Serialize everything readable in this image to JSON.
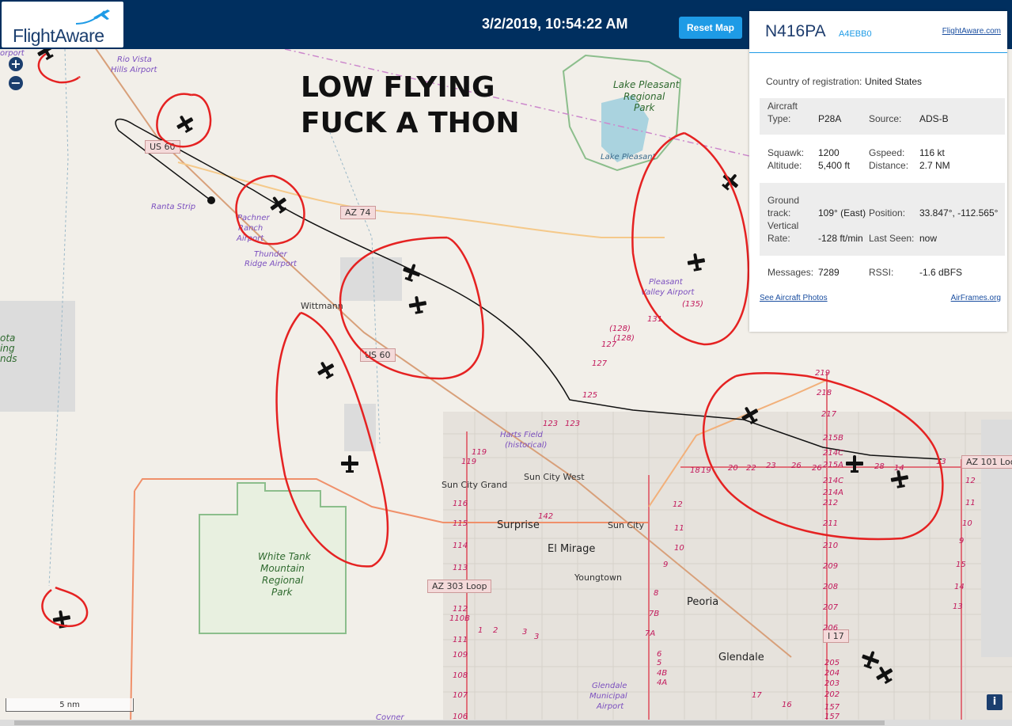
{
  "header": {
    "logo_text": "FlightAware",
    "timestamp": "3/2/2019, 10:54:22 AM",
    "reset_label": "Reset Map"
  },
  "overlay": {
    "line1": "LOW FLYING",
    "line2": "FUCK A THON"
  },
  "panel": {
    "registration": "N416PA",
    "hex": "A4EBB0",
    "site_link": "FlightAware.com",
    "country_label": "Country of registration:",
    "country": "United States",
    "aircraft_label": "Aircraft",
    "type_label": "Type:",
    "type": "P28A",
    "source_label": "Source:",
    "source": "ADS-B",
    "squawk_label": "Squawk:",
    "squawk": "1200",
    "gspeed_label": "Gspeed:",
    "gspeed": "116 kt",
    "altitude_label": "Altitude:",
    "altitude": "5,400 ft",
    "distance_label": "Distance:",
    "distance": "2.7 NM",
    "ground_label": "Ground",
    "track_label": "track:",
    "track": "109° (East)",
    "position_label": "Position:",
    "position": "33.847°, -112.565°",
    "vertical_label": "Vertical",
    "rate_label": "Rate:",
    "rate": "-128 ft/min",
    "lastseen_label": "Last Seen:",
    "lastseen": "now",
    "messages_label": "Messages:",
    "messages": "7289",
    "rssi_label": "RSSI:",
    "rssi": "-1.6 dBFS",
    "photos_link": "See Aircraft Photos",
    "airframes_link": "AirFrames.org"
  },
  "map": {
    "zoom_in": "+",
    "zoom_out": "−",
    "scale_label": "5 nm",
    "info_label": "i",
    "place_labels": [
      {
        "text": "Rio Vista",
        "kind": "airport"
      },
      {
        "text": "Hills Airport",
        "kind": "airport"
      },
      {
        "text": "Lake Pleasant",
        "kind": "park"
      },
      {
        "text": "Regional",
        "kind": "park"
      },
      {
        "text": "Park",
        "kind": "park"
      },
      {
        "text": "Lake Pleasant",
        "kind": "water"
      },
      {
        "text": "Ranta Strip",
        "kind": "airport"
      },
      {
        "text": "Pachner",
        "kind": "airport"
      },
      {
        "text": "Ranch",
        "kind": "airport"
      },
      {
        "text": "Airport",
        "kind": "airport"
      },
      {
        "text": "Thunder",
        "kind": "airport"
      },
      {
        "text": "Ridge Airport",
        "kind": "airport"
      },
      {
        "text": "Wittmann",
        "kind": "town"
      },
      {
        "text": "Pleasant",
        "kind": "airport"
      },
      {
        "text": "Valley Airport",
        "kind": "airport"
      },
      {
        "text": "Harts Field",
        "kind": "airport"
      },
      {
        "text": "(historical)",
        "kind": "airport"
      },
      {
        "text": "Sun City Grand",
        "kind": "town"
      },
      {
        "text": "Sun City West",
        "kind": "town"
      },
      {
        "text": "Surprise",
        "kind": "city"
      },
      {
        "text": "Sun City",
        "kind": "town"
      },
      {
        "text": "El Mirage",
        "kind": "city"
      },
      {
        "text": "Youngtown",
        "kind": "town"
      },
      {
        "text": "White Tank",
        "kind": "park"
      },
      {
        "text": "Mountain",
        "kind": "park"
      },
      {
        "text": "Regional",
        "kind": "park"
      },
      {
        "text": "Park",
        "kind": "park"
      },
      {
        "text": "Peoria",
        "kind": "city"
      },
      {
        "text": "Glendale",
        "kind": "city"
      },
      {
        "text": "Glendale",
        "kind": "airport"
      },
      {
        "text": "Municipal",
        "kind": "airport"
      },
      {
        "text": "Airport",
        "kind": "airport"
      },
      {
        "text": "Coyner",
        "kind": "airport"
      },
      {
        "text": "orport",
        "kind": "airport"
      },
      {
        "text": "ota",
        "kind": "park"
      },
      {
        "text": "ing",
        "kind": "park"
      },
      {
        "text": "nds",
        "kind": "park"
      }
    ],
    "road_shields": [
      "US 60",
      "AZ 74",
      "US 60",
      "AZ 303 Loop",
      "AZ 101 Loo",
      "I 17"
    ],
    "road_numbers": [
      "(135)",
      "131",
      "(128)",
      "127",
      "(128)",
      "127",
      "125",
      "123",
      "123",
      "142",
      "119",
      "119",
      "116",
      "115",
      "114",
      "113",
      "112",
      "110B",
      "111",
      "109",
      "108",
      "107",
      "106",
      "1",
      "2",
      "3",
      "3",
      "219",
      "218",
      "217",
      "215B",
      "214C",
      "215A",
      "214C",
      "214A",
      "212",
      "211",
      "210",
      "209",
      "208",
      "207",
      "206",
      "205",
      "204",
      "203",
      "202",
      "157",
      "157",
      "17",
      "16",
      "18",
      "19",
      "20",
      "22",
      "23",
      "26",
      "26",
      "28",
      "14",
      "13",
      "12",
      "11",
      "10",
      "9",
      "15",
      "14",
      "13",
      "12",
      "11",
      "10",
      "9",
      "8",
      "7B",
      "7A",
      "6",
      "5",
      "4B",
      "4A"
    ]
  },
  "colors": {
    "header_bg": "#002f5f",
    "accent": "#1e9be6",
    "annotation": "#e52222",
    "map_bg": "#f2efe9"
  }
}
